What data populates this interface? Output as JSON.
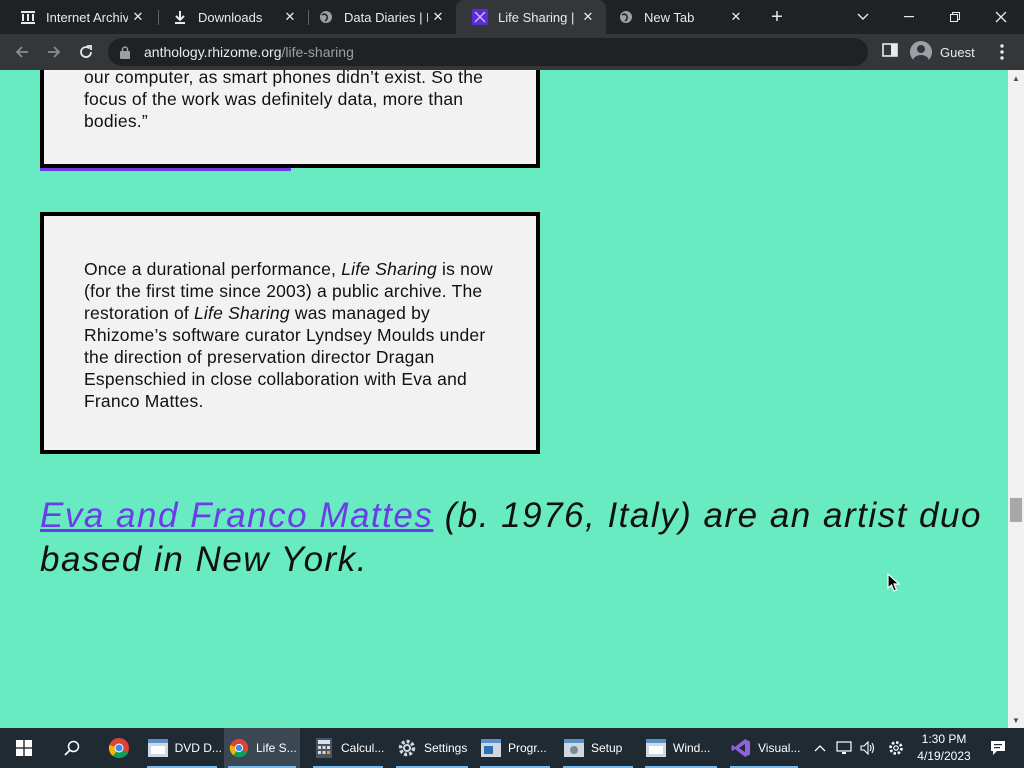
{
  "browser": {
    "tabs": [
      {
        "title": "Internet Archive",
        "icon": "archive-icon"
      },
      {
        "title": "Downloads",
        "icon": "download-icon"
      },
      {
        "title": "Data Diaries | N",
        "icon": "globe-icon"
      },
      {
        "title": "Life Sharing | N",
        "icon": "rhizome-icon",
        "active": true
      },
      {
        "title": "New Tab",
        "icon": "globe-icon"
      }
    ],
    "close_glyph": "✕",
    "new_tab_glyph": "+",
    "url_host": "anthology.rhizome.org",
    "url_path": "/life-sharing",
    "profile_label": "Guest"
  },
  "page": {
    "box1_text": "our computer, as smart phones didn’t exist. So the focus of the work was definitely data, more than bodies.”",
    "box2": {
      "p1": "Once a durational performance, ",
      "em1": "Life Sharing",
      "p2": " is now (for the first time since 2003) a public archive. The restoration of ",
      "em2": "Life Sharing",
      "p3": " was managed by Rhizome’s software curator Lyndsey Moulds under the direction of preservation director Dragan Espenschied in close collaboration with Eva and Franco Mattes."
    },
    "bio_link": "Eva and Franco Mattes",
    "bio_text": " (b. 1976, Italy) are an artist duo based in New York."
  },
  "taskbar": {
    "items": [
      {
        "label": "",
        "icon": "chrome-icon"
      },
      {
        "label": "DVD D...",
        "icon": "app-window-icon"
      },
      {
        "label": "Life S...",
        "icon": "chrome-icon"
      },
      {
        "label": "Calcul...",
        "icon": "calculator-icon"
      },
      {
        "label": "Settings",
        "icon": "gear-icon"
      },
      {
        "label": "Progr...",
        "icon": "app-window-icon"
      },
      {
        "label": "Setup",
        "icon": "app-window-icon"
      },
      {
        "label": "Wind...",
        "icon": "app-window-icon"
      },
      {
        "label": "Visual...",
        "icon": "visual-studio-icon"
      }
    ],
    "time": "1:30 PM",
    "date": "4/19/2023"
  },
  "colors": {
    "page_bg": "#69ebc1",
    "accent_purple": "#6a3de8",
    "box_bg": "#f2f2f2"
  }
}
